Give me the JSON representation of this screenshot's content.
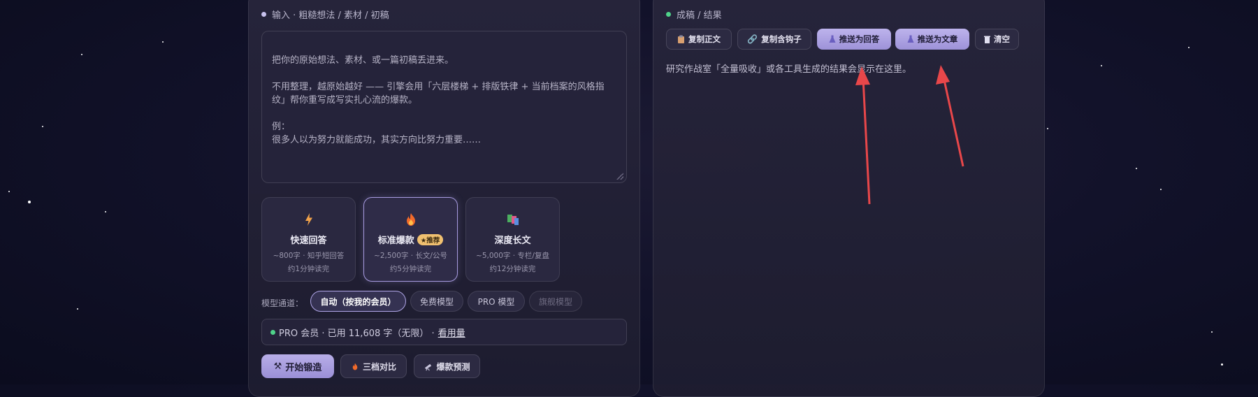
{
  "left": {
    "title": "输入 · 粗糙想法 / 素材 / 初稿",
    "textarea_placeholder": "把你的原始想法、素材、或一篇初稿丢进来。\n\n不用整理，越原始越好 —— 引擎会用「六层楼梯 + 排版铁律 + 当前档案的风格指纹」帮你重写成写实扎心流的爆款。\n\n例：\n很多人以为努力就能成功，其实方向比努力重要……",
    "modes": [
      {
        "name": "快速回答",
        "desc": "~800字 · 知乎短回答",
        "time": "约1分钟读完",
        "icon": "lightning-icon"
      },
      {
        "name": "标准爆款",
        "badge": "★推荐",
        "desc": "~2,500字 · 长文/公号",
        "time": "约5分钟读完",
        "icon": "fire-icon"
      },
      {
        "name": "深度长文",
        "desc": "~5,000字 · 专栏/复盘",
        "time": "约12分钟读完",
        "icon": "books-icon"
      }
    ],
    "channel_label": "模型通道：",
    "channels": [
      "自动（按我的会员）",
      "免费模型",
      "PRO 模型",
      "旗舰模型"
    ],
    "usage_text": "PRO 会员 · 已用 11,608 字（无限） ·",
    "usage_link": "看用量",
    "actions": {
      "start": "开始锻造",
      "compare": "三档对比",
      "predict": "爆款预测"
    }
  },
  "right": {
    "title": "成稿 / 结果",
    "tools": {
      "copy_body": "复制正文",
      "copy_hook": "复制含钩子",
      "push_answer": "推送为回答",
      "push_article": "推送为文章",
      "clear": "清空"
    },
    "placeholder": "研究作战室「全量吸收」或各工具生成的结果会显示在这里。"
  },
  "colors": {
    "accent": "#a79be0",
    "green_dot": "#4fd38a",
    "arrow": "#e8474a",
    "badge": "#f0c070"
  }
}
